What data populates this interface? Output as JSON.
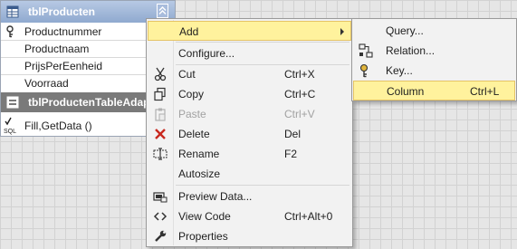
{
  "table": {
    "title": "tblProducten",
    "columns": [
      {
        "name": "Productnummer",
        "primary_key": true
      },
      {
        "name": "Productnaam",
        "primary_key": false
      },
      {
        "name": "PrijsPerEenheid",
        "primary_key": false
      },
      {
        "name": "Voorraad",
        "primary_key": false
      }
    ],
    "adapter_title": "tblProductenTableAdap",
    "query": "Fill,GetData ()",
    "query_icon_text": "SQL"
  },
  "context_menu": {
    "items": [
      {
        "label": "Add",
        "shortcut": "",
        "icon": "none",
        "submenu": true,
        "highlighted": true
      },
      {
        "label": "Configure...",
        "shortcut": "",
        "icon": "none"
      },
      {
        "label": "Cut",
        "shortcut": "Ctrl+X",
        "icon": "scissors-icon"
      },
      {
        "label": "Copy",
        "shortcut": "Ctrl+C",
        "icon": "copy-icon"
      },
      {
        "label": "Paste",
        "shortcut": "Ctrl+V",
        "icon": "paste-icon",
        "disabled": true
      },
      {
        "label": "Delete",
        "shortcut": "Del",
        "icon": "delete-x-icon"
      },
      {
        "label": "Rename",
        "shortcut": "F2",
        "icon": "rename-icon"
      },
      {
        "label": "Autosize",
        "shortcut": "",
        "icon": "none"
      },
      {
        "label": "Preview Data...",
        "shortcut": "",
        "icon": "preview-data-icon"
      },
      {
        "label": "View Code",
        "shortcut": "Ctrl+Alt+0",
        "icon": "code-brackets-icon"
      },
      {
        "label": "Properties",
        "shortcut": "",
        "icon": "wrench-icon"
      }
    ]
  },
  "submenu": {
    "items": [
      {
        "label": "Query...",
        "shortcut": "",
        "icon": "none"
      },
      {
        "label": "Relation...",
        "shortcut": "",
        "icon": "relation-icon"
      },
      {
        "label": "Key...",
        "shortcut": "",
        "icon": "key-icon"
      },
      {
        "label": "Column",
        "shortcut": "Ctrl+L",
        "icon": "none",
        "highlighted": true
      }
    ]
  },
  "colors": {
    "highlight": "#fff29d",
    "highlight_border": "#e5c365",
    "header_blue": "#8fa9cf",
    "delete_red": "#c8281e"
  }
}
